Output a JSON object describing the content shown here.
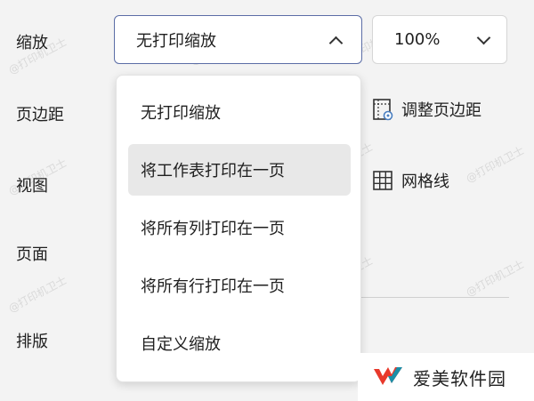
{
  "labels": {
    "scale": "缩放",
    "margins": "页边距",
    "view": "视图",
    "page": "页面",
    "layout": "排版"
  },
  "scale_select": {
    "value": "无打印缩放",
    "icon": "chevron-up-icon"
  },
  "zoom_select": {
    "value": "100%",
    "icon": "chevron-down-icon"
  },
  "scale_options": [
    {
      "label": "无打印缩放",
      "highlighted": false
    },
    {
      "label": "将工作表打印在一页",
      "highlighted": true
    },
    {
      "label": "将所有列打印在一页",
      "highlighted": false
    },
    {
      "label": "将所有行打印在一页",
      "highlighted": false
    },
    {
      "label": "自定义缩放",
      "highlighted": false
    }
  ],
  "right_panel": {
    "adjust_margins": {
      "label": "调整页边距",
      "icon": "page-margin-settings-icon"
    },
    "gridlines": {
      "label": "网格线",
      "icon": "grid-icon"
    }
  },
  "watermark": "@打印机卫士",
  "brand": {
    "name": "爱美软件园",
    "logo": "brand-logo-icon",
    "colors": {
      "red": "#e8392b",
      "teal": "#1b8fa8"
    }
  },
  "colors": {
    "focus_border": "#5b6da6",
    "highlight": "#e8e8e8"
  }
}
